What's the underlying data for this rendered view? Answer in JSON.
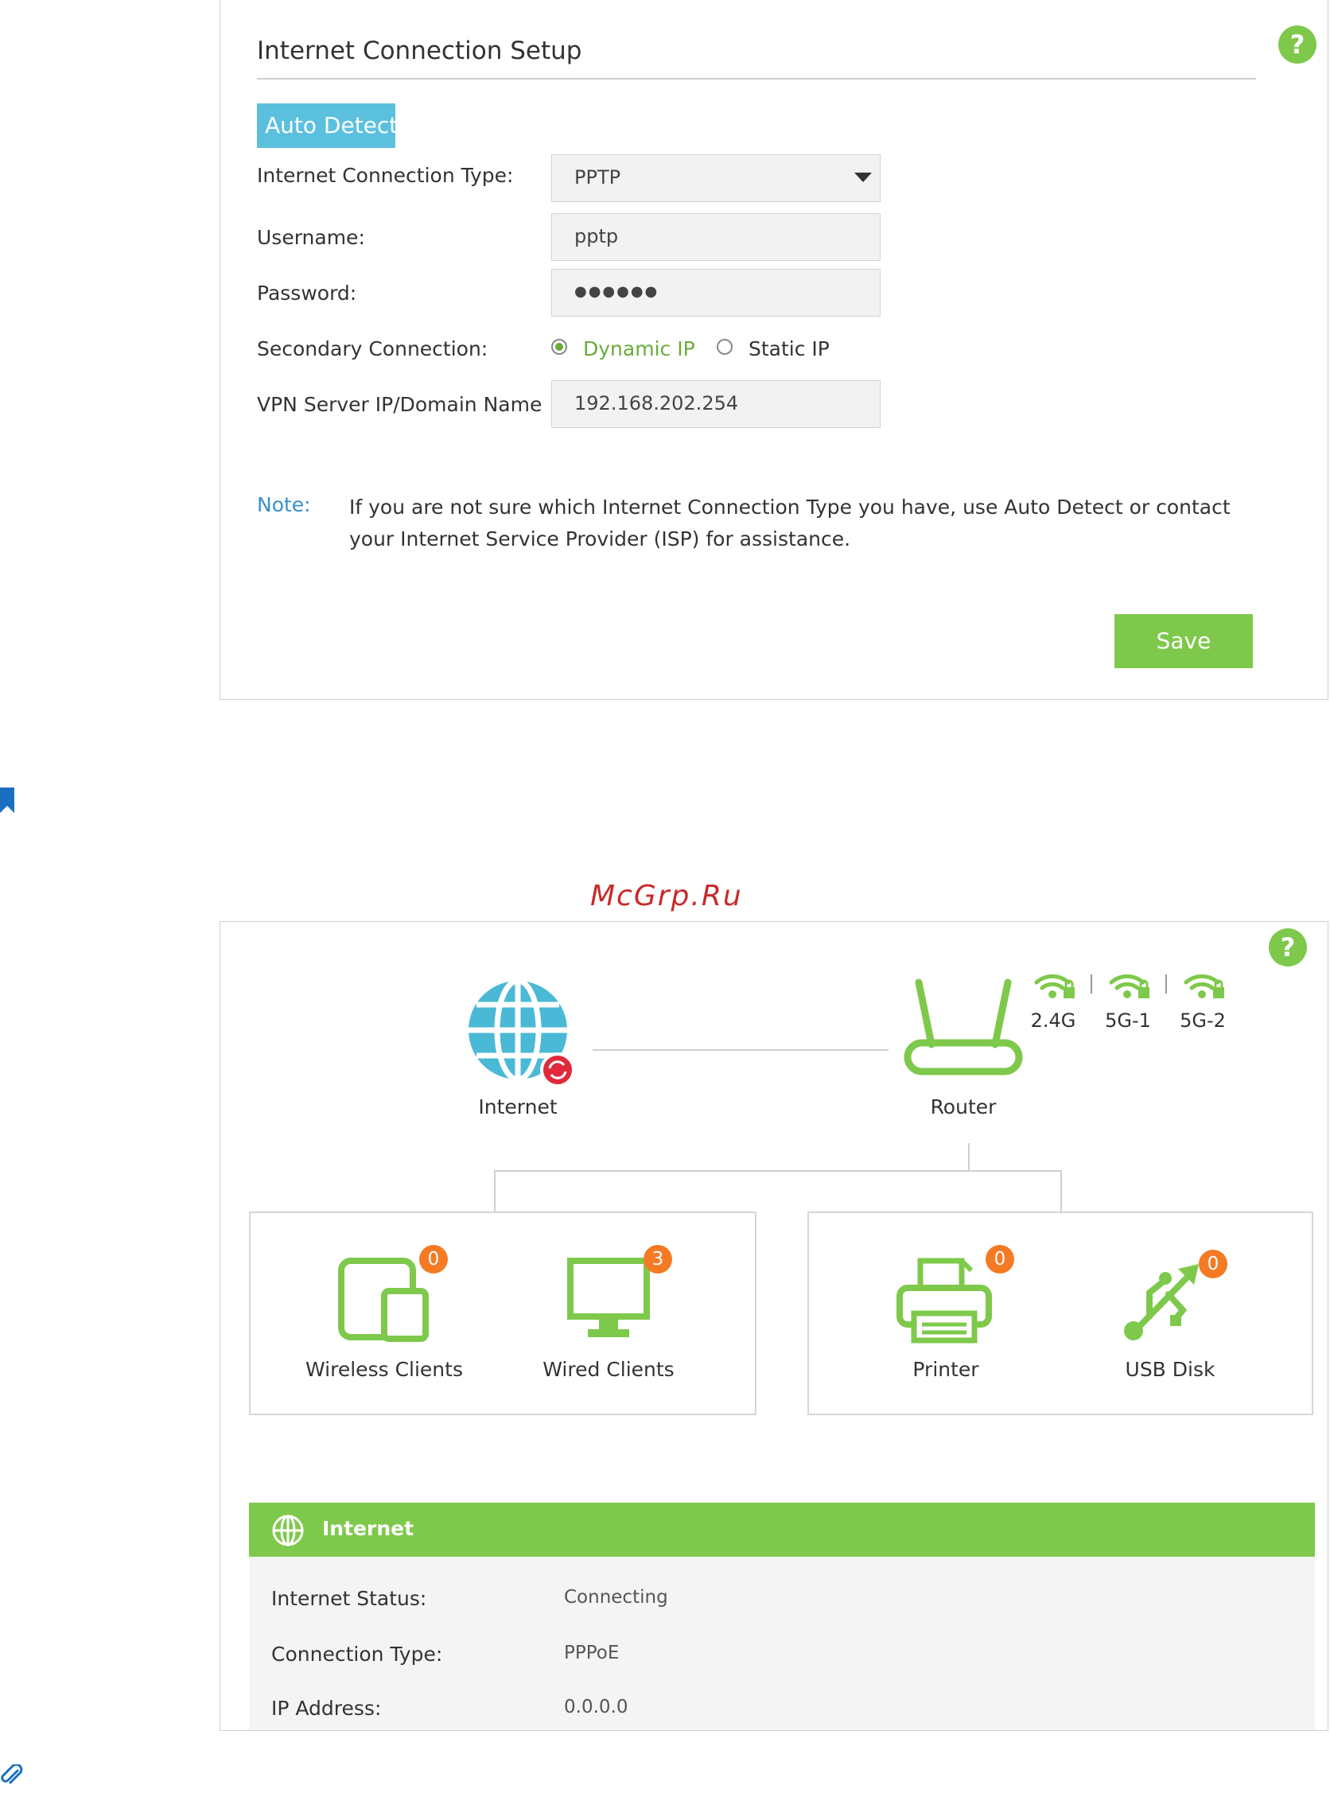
{
  "setup": {
    "title": "Internet Connection Setup",
    "help": "?",
    "auto_detect_label": "Auto Detect",
    "connection_type_label": "Internet Connection Type:",
    "connection_type_value": "PPTP",
    "username_label": "Username:",
    "username_value": "pptp",
    "password_label": "Password:",
    "password_value": "●●●●●●",
    "secondary_label": "Secondary Connection:",
    "secondary_options": [
      "Dynamic IP",
      "Static IP"
    ],
    "secondary_selected": "Dynamic IP",
    "vpn_label": "VPN Server IP/Domain Name",
    "vpn_value": "192.168.202.254",
    "note_label": "Note:",
    "note_text": "If you are not sure which Internet Connection Type you have, use Auto Detect or contact your Internet Service Provider (ISP) for assistance.",
    "save_label": "Save"
  },
  "watermark": "McGrp.Ru",
  "map": {
    "help": "?",
    "internet_label": "Internet",
    "router_label": "Router",
    "bands": [
      "2.4G",
      "5G-1",
      "5G-2"
    ],
    "devices": {
      "wireless": {
        "label": "Wireless Clients",
        "count": "0"
      },
      "wired": {
        "label": "Wired Clients",
        "count": "3"
      },
      "printer": {
        "label": "Printer",
        "count": "0"
      },
      "usb": {
        "label": "USB Disk",
        "count": "0"
      }
    },
    "status": {
      "title": "Internet",
      "rows": [
        {
          "label": "Internet Status:",
          "value": "Connecting"
        },
        {
          "label": "Connection Type:",
          "value": "PPPoE"
        },
        {
          "label": "IP Address:",
          "value": "0.0.0.0"
        }
      ]
    }
  },
  "colors": {
    "accent_green": "#7ec94b",
    "auto_detect_blue": "#5bc0de",
    "globe_blue": "#4ab9d6",
    "alert_red": "#e0293a",
    "badge_orange": "#f47a24"
  }
}
